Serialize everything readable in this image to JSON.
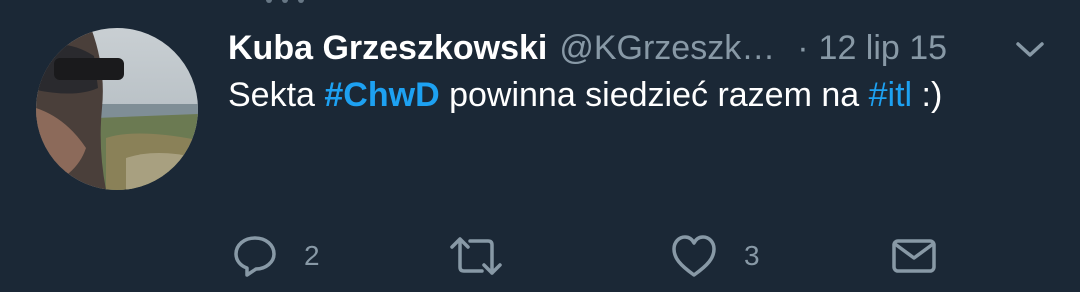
{
  "tweet": {
    "display_name": "Kuba Grzeszkowski",
    "handle": "@KGrzeszk…",
    "separator": "·",
    "time": "12 lip 15",
    "text_parts": {
      "p1": "Sekta ",
      "h1": "#ChwD",
      "p2": " powinna siedzieć razem na ",
      "h2": "#itl",
      "p3": " :)"
    },
    "actions": {
      "reply_icon": "reply-icon",
      "reply_count": "2",
      "retweet_icon": "retweet-icon",
      "like_icon": "heart-icon",
      "like_count": "3",
      "dm_icon": "envelope-icon"
    },
    "caret_icon": "chevron-down-icon"
  },
  "colors": {
    "background": "#1b2836",
    "text": "#ffffff",
    "secondary": "#8899a6",
    "link": "#1da1f2"
  }
}
